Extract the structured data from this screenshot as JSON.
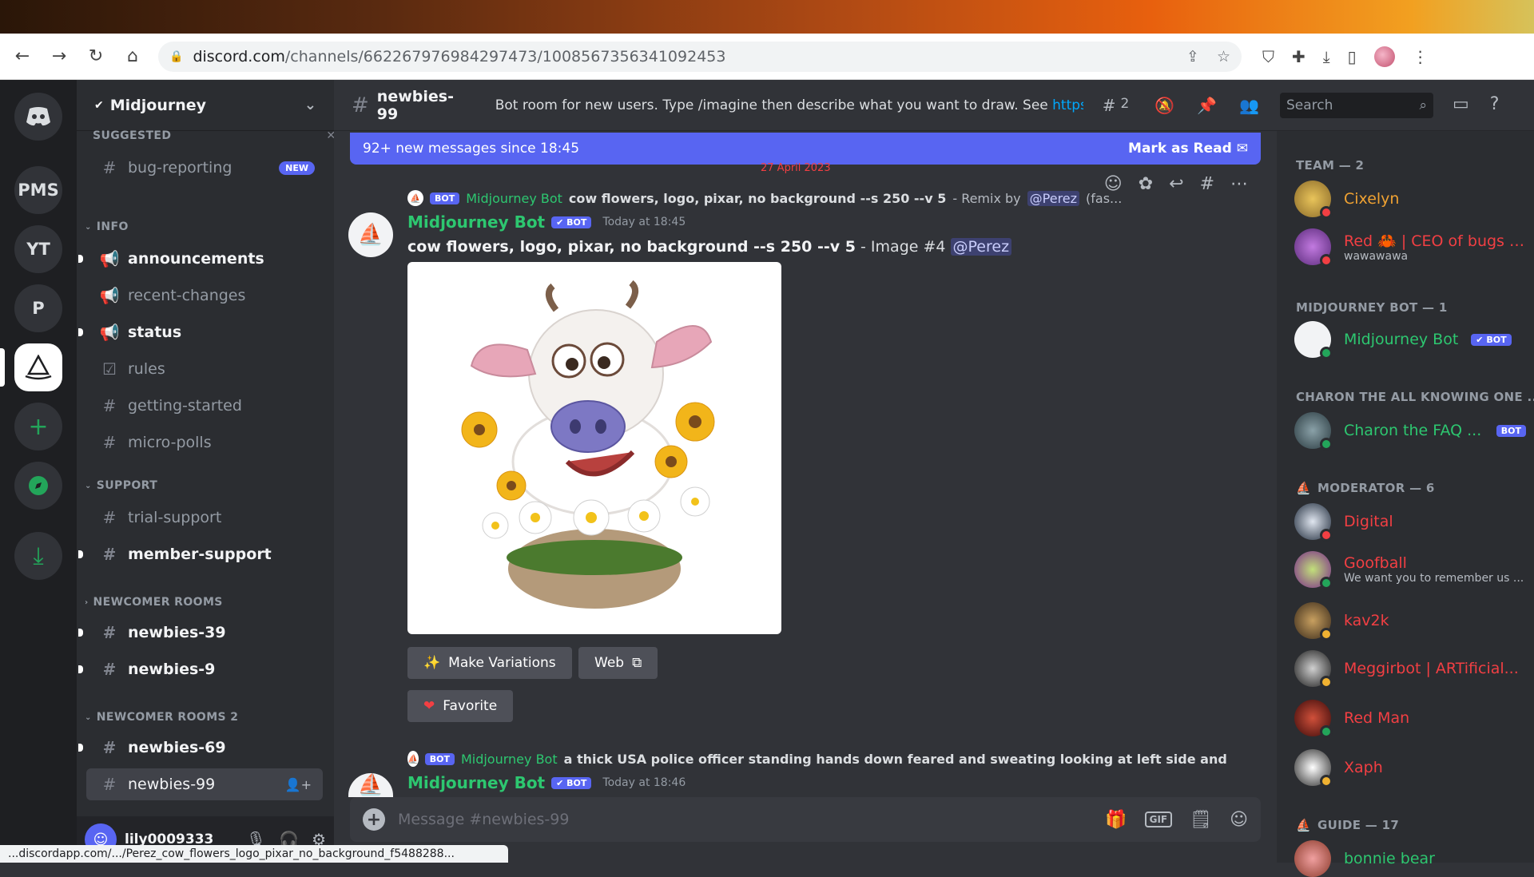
{
  "browser": {
    "url_host": "discord.com",
    "url_path": "/channels/662267976984297473/1008567356341092453",
    "status_url": "...discordapp.com/.../Perez_cow_flowers_logo_pixar_no_background_f5488288..."
  },
  "rail": {
    "servers": [
      "PMS",
      "YT",
      "P"
    ]
  },
  "server": {
    "name": "Midjourney"
  },
  "sidebar": {
    "suggested_label": "SUGGESTED",
    "suggested_channel": "bug-reporting",
    "new_badge": "NEW",
    "cat_info": "INFO",
    "cat_support": "SUPPORT",
    "cat_newcomer": "NEWCOMER ROOMS",
    "cat_newcomer2": "NEWCOMER ROOMS 2",
    "channels": {
      "announcements": "announcements",
      "recent_changes": "recent-changes",
      "status": "status",
      "rules": "rules",
      "getting_started": "getting-started",
      "micro_polls": "micro-polls",
      "trial_support": "trial-support",
      "member_support": "member-support",
      "newbies_39": "newbies-39",
      "newbies_9": "newbies-9",
      "newbies_69": "newbies-69",
      "newbies_99": "newbies-99"
    },
    "user": {
      "name": "lily0009333"
    }
  },
  "channel": {
    "name": "newbies-99",
    "topic": "Bot room for new users. Type /imagine then describe what you want to draw. See ",
    "topic_link": "https://...",
    "threads_count": "2",
    "new_messages": "92+ new messages since 18:45",
    "mark_as_read": "Mark as Read",
    "date_divider": "27 April 2023"
  },
  "messages": {
    "m1": {
      "reply_bot_badge": "BOT",
      "reply_author": "Midjourney Bot",
      "reply_prompt": "cow flowers, logo, pixar, no background --s 250 --v 5",
      "reply_suffix": " - Remix by ",
      "reply_mention": "@Perez",
      "reply_tail": " (fas...",
      "author": "Midjourney Bot",
      "bot_badge": "BOT",
      "timestamp": "Today at 18:45",
      "body_prompt": "cow flowers, logo, pixar, no background --s 250 --v 5",
      "body_suffix": " - Image #4 ",
      "body_mention": "@Perez",
      "btn_variations": "Make Variations",
      "btn_web": "Web",
      "btn_favorite": "Favorite"
    },
    "m2": {
      "reply_bot_badge": "BOT",
      "reply_author": "Midjourney Bot",
      "reply_prompt": "a thick USA police officer standing hands down feared and sweating looking at left side and s",
      "author": "Midjourney Bot",
      "bot_badge": "BOT",
      "timestamp": "Today at 18:46"
    }
  },
  "composer": {
    "placeholder": "Message #newbies-99",
    "gif": "GIF"
  },
  "members": {
    "search_placeholder": "Search",
    "cat_team": "TEAM — 2",
    "cat_mjbot": "MIDJOURNEY BOT — 1",
    "cat_charon": "CHARON THE ALL KNOWING ONE ...",
    "cat_moderator": "MODERATOR — 6",
    "cat_guide": "GUIDE — 17",
    "bot_badge": "BOT",
    "list": {
      "cixelyn": "Cixelyn",
      "red": "Red 🦀 | CEO of bugs 🐛",
      "red_sub": "wawawawa",
      "mjbot": "Midjourney Bot",
      "charon": "Charon the FAQ ...",
      "digital": "Digital",
      "goofball": "Goofball",
      "goofball_sub": "We want you to remember us ...",
      "kav2k": "kav2k",
      "meggirbot": "Meggirbot | ARTificial...",
      "redman": "Red Man",
      "xaph": "Xaph",
      "bonnie": "bonnie bear"
    }
  },
  "colors": {
    "accent": "#5865f2",
    "bot_green": "#2dc770",
    "mod_red": "#f23f43",
    "team_orange": "#f0a232"
  }
}
